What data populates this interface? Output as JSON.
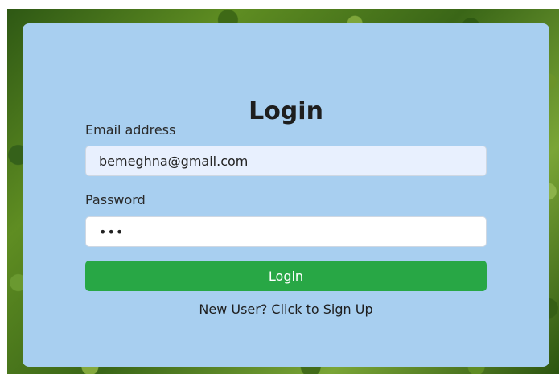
{
  "login_form": {
    "title": "Login",
    "email_label": "Email address",
    "email_value": "bemeghna@gmail.com",
    "password_label": "Password",
    "password_value": "•••",
    "login_button_label": "Login",
    "signup_link_text": "New User? Click to Sign Up"
  },
  "colors": {
    "card_background": "#a8cff0",
    "login_button": "#28a745",
    "email_input_background": "#e8f0fe"
  }
}
